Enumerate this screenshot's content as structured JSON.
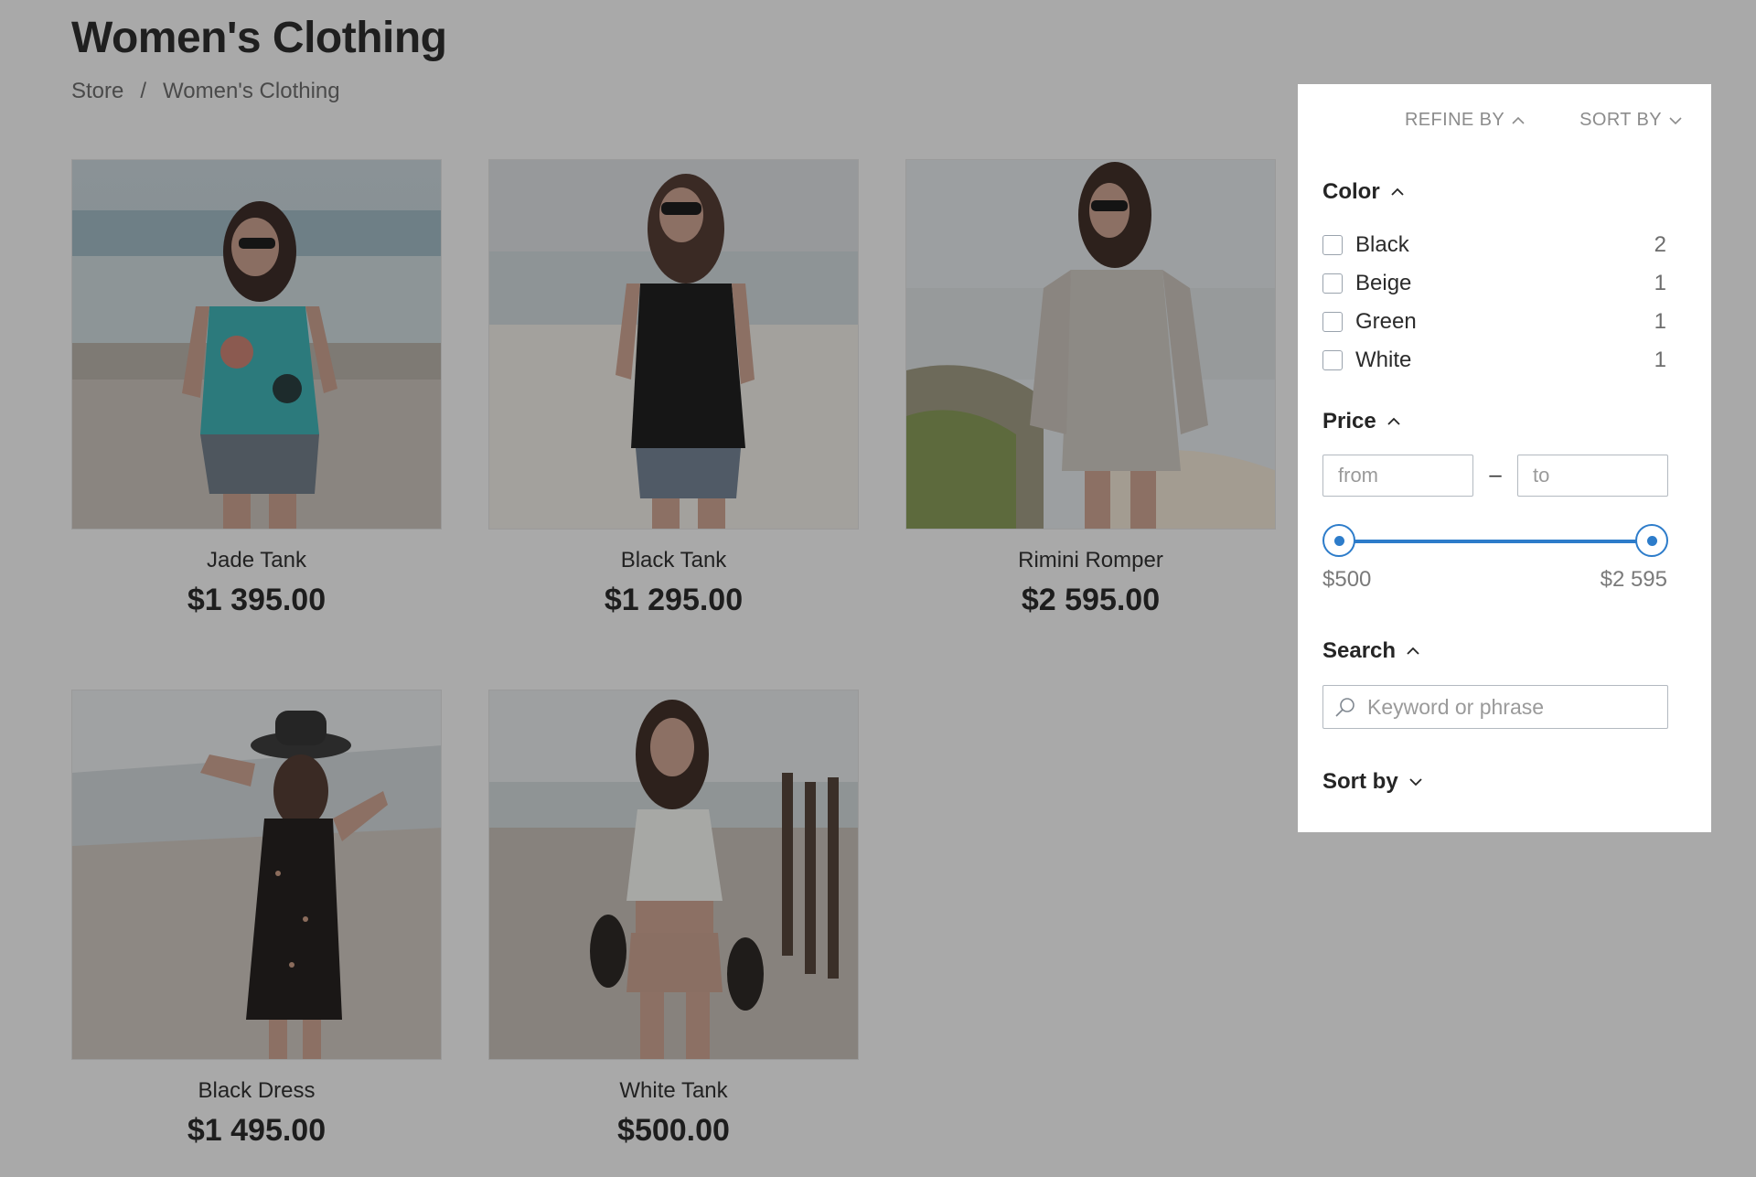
{
  "page": {
    "title": "Women's Clothing"
  },
  "breadcrumb": {
    "store": "Store",
    "separator": "/",
    "current": "Women's Clothing"
  },
  "products": [
    {
      "name": "Jade Tank",
      "price": "$1 395.00"
    },
    {
      "name": "Black Tank",
      "price": "$1 295.00"
    },
    {
      "name": "Rimini Romper",
      "price": "$2 595.00"
    },
    {
      "name": "Black Dress",
      "price": "$1 495.00"
    },
    {
      "name": "White Tank",
      "price": "$500.00"
    }
  ],
  "panel": {
    "refine_by": "REFINE BY",
    "sort_by": "SORT BY",
    "color_heading": "Color",
    "colors": [
      {
        "label": "Black",
        "count": "2"
      },
      {
        "label": "Beige",
        "count": "1"
      },
      {
        "label": "Green",
        "count": "1"
      },
      {
        "label": "White",
        "count": "1"
      }
    ],
    "price_heading": "Price",
    "price_from_placeholder": "from",
    "price_to_placeholder": "to",
    "price_dash": "–",
    "price_min_label": "$500",
    "price_max_label": "$2 595",
    "search_heading": "Search",
    "search_placeholder": "Keyword or phrase",
    "sort_heading": "Sort by"
  },
  "colors": {
    "accent": "#2d7cca",
    "overlay_bg": "#a9a9a9",
    "panel_bg": "#ffffff"
  }
}
